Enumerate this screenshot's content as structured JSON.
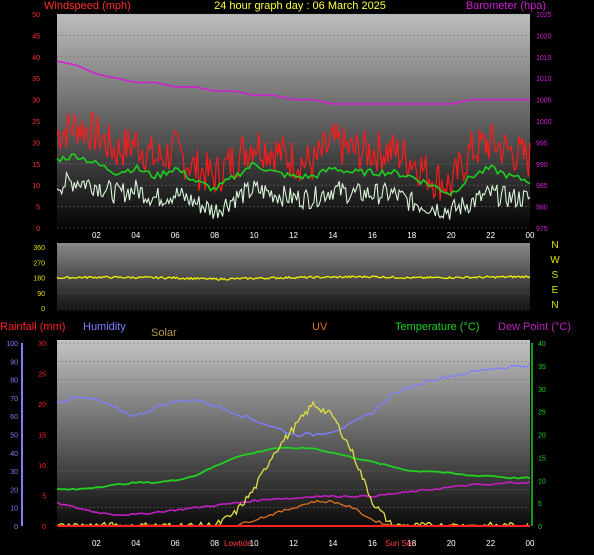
{
  "title": "24 hour graph day : 06 March 2025",
  "colors": {
    "wind_avg": "#1ecf1e",
    "wind_gust": "#ff1a1a",
    "wind_white": "#d8f5d8",
    "barometer": "#d020d0",
    "direction": "#f0f000",
    "humidity": "#7f7fff",
    "solar": "#e0e040",
    "uv": "#e07020",
    "temperature": "#20d020",
    "dewpoint": "#c020c0",
    "rain": "#ff2020"
  },
  "chart_data": [
    {
      "type": "line",
      "panel": "wind_barometer",
      "left_axis_label": "Windspeed (mph)",
      "right_axis_label": "Barometer (hpa)",
      "x_ticks": [
        "02",
        "04",
        "06",
        "08",
        "10",
        "12",
        "14",
        "16",
        "18",
        "20",
        "22",
        "00"
      ],
      "left_ticks": [
        "0",
        "5",
        "10",
        "15",
        "20",
        "25",
        "30",
        "35",
        "40",
        "45",
        "50"
      ],
      "left_ylim": [
        0,
        50
      ],
      "right_ticks": [
        "975",
        "980",
        "985",
        "990",
        "995",
        "1000",
        "1005",
        "1010",
        "1015",
        "1020",
        "1025"
      ],
      "right_ylim": [
        975,
        1025
      ],
      "x": [
        0,
        1,
        2,
        3,
        4,
        5,
        6,
        7,
        8,
        9,
        10,
        11,
        12,
        13,
        14,
        15,
        16,
        17,
        18,
        19,
        20,
        21,
        22,
        23,
        24
      ],
      "series": [
        {
          "key": "wind_gust",
          "values": [
            22,
            24,
            22,
            18,
            20,
            16,
            18,
            14,
            12,
            16,
            20,
            18,
            16,
            15,
            20,
            18,
            18,
            18,
            16,
            12,
            10,
            18,
            20,
            18,
            16
          ]
        },
        {
          "key": "wind_avg",
          "values": [
            16,
            17,
            15,
            13,
            14,
            12,
            14,
            11,
            9,
            12,
            15,
            13,
            12,
            12,
            14,
            13,
            13,
            13,
            12,
            10,
            8,
            12,
            14,
            12,
            11
          ]
        },
        {
          "key": "wind_white",
          "values": [
            10,
            11,
            10,
            8,
            9,
            7,
            8,
            6,
            4,
            7,
            9,
            8,
            7,
            7,
            9,
            8,
            8,
            8,
            6,
            5,
            4,
            6,
            8,
            7,
            7
          ]
        },
        {
          "key": "barometer",
          "values": [
            1014,
            1013,
            1011,
            1010,
            1009,
            1009,
            1008,
            1008,
            1007,
            1007,
            1006,
            1006,
            1005,
            1005,
            1004,
            1004,
            1004,
            1004,
            1004,
            1004,
            1004,
            1005,
            1005,
            1005,
            1005
          ]
        }
      ]
    },
    {
      "type": "line",
      "panel": "wind_direction",
      "left_ticks": [
        "360",
        "270",
        "180",
        "90",
        "0"
      ],
      "ylim": [
        0,
        360
      ],
      "compass_labels": [
        "N",
        "W",
        "S",
        "E",
        "N"
      ],
      "x": [
        0,
        2,
        4,
        6,
        8,
        10,
        12,
        14,
        16,
        18,
        20,
        22,
        24
      ],
      "series": [
        {
          "key": "direction",
          "values": [
            178,
            182,
            180,
            178,
            170,
            175,
            180,
            182,
            185,
            178,
            180,
            182,
            185
          ]
        }
      ]
    },
    {
      "type": "line",
      "panel": "rain_humidity_temp",
      "labels": {
        "rainfall": "Rainfall (mm)",
        "humidity": "Humidity",
        "solar": "Solar",
        "uv": "UV",
        "temperature": "Temperature (°C)",
        "dewpoint": "Dew Point (°C)"
      },
      "x_ticks": [
        "02",
        "04",
        "06",
        "08",
        "10",
        "12",
        "14",
        "16",
        "18",
        "20",
        "22",
        "00"
      ],
      "humidity_ticks": [
        "0",
        "10",
        "20",
        "30",
        "40",
        "50",
        "60",
        "70",
        "80",
        "90",
        "100"
      ],
      "humidity_ylim": [
        0,
        100
      ],
      "rain_ticks": [
        "0",
        "5",
        "10",
        "15",
        "20",
        "25",
        "30"
      ],
      "rain_ylim": [
        0,
        30
      ],
      "temp_ticks": [
        "0",
        "5",
        "10",
        "15",
        "20",
        "25",
        "30",
        "35",
        "40"
      ],
      "temp_ylim": [
        0,
        40
      ],
      "events": [
        "Lowtide",
        "Sun Set"
      ],
      "x": [
        0,
        1,
        2,
        3,
        4,
        5,
        6,
        7,
        8,
        9,
        10,
        11,
        12,
        13,
        14,
        15,
        16,
        17,
        18,
        19,
        20,
        21,
        22,
        23,
        24
      ],
      "series": [
        {
          "key": "humidity",
          "values": [
            68,
            70,
            69,
            64,
            60,
            65,
            68,
            69,
            66,
            62,
            58,
            54,
            50,
            50,
            52,
            56,
            62,
            72,
            76,
            80,
            82,
            84,
            86,
            87,
            88
          ]
        },
        {
          "key": "temperature",
          "values": [
            8,
            8,
            8.5,
            9,
            9.5,
            9.5,
            10,
            11,
            13,
            15,
            16,
            17,
            17,
            17,
            16,
            15,
            14,
            13,
            12,
            12,
            11.5,
            11,
            11,
            10.5,
            10.5
          ]
        },
        {
          "key": "dewpoint",
          "values": [
            5,
            4,
            3,
            2.5,
            2.5,
            3,
            3.5,
            4,
            4.5,
            5,
            5.5,
            6,
            6,
            6.5,
            6.5,
            6.5,
            6.5,
            7,
            7.5,
            8,
            8.5,
            9,
            9,
            9.5,
            9.5
          ]
        },
        {
          "key": "solar",
          "values": [
            0,
            0,
            0,
            0,
            0,
            0,
            0,
            0,
            0,
            2,
            6,
            12,
            16,
            20,
            18,
            12,
            4,
            0,
            0,
            0,
            0,
            0,
            0,
            0,
            0
          ]
        },
        {
          "key": "uv",
          "values": [
            0,
            0,
            0,
            0,
            0,
            0,
            0,
            0,
            0,
            0,
            1,
            2,
            3,
            4,
            4,
            3,
            1,
            0,
            0,
            0,
            0,
            0,
            0,
            0,
            0
          ]
        },
        {
          "key": "rain",
          "values": [
            0,
            0,
            0,
            0,
            0,
            0,
            0,
            0,
            0,
            0,
            0,
            0,
            0,
            0,
            0,
            0,
            0,
            0,
            0,
            0,
            0,
            0,
            0,
            0,
            0
          ]
        }
      ]
    }
  ]
}
